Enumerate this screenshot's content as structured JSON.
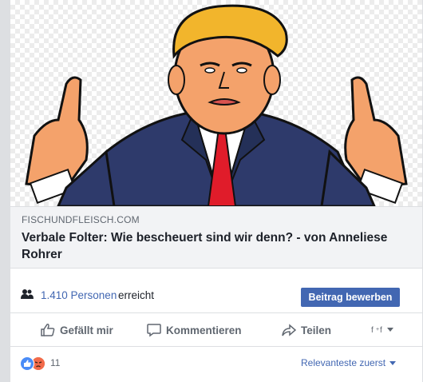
{
  "link_preview": {
    "domain": "FISCHUNDFLEISCH.COM",
    "title": "Verbale Folter: Wie bescheuert sind wir denn? - von Anneliese Rohrer"
  },
  "reach": {
    "count": "1.410 Personen",
    "suffix": "erreicht",
    "boost_label": "Beitrag bewerben"
  },
  "actions": {
    "like": "Gefällt mir",
    "comment": "Kommentieren",
    "share": "Teilen"
  },
  "reactions": {
    "count": "11",
    "sort_label": "Relevanteste zuerst"
  },
  "colors": {
    "accent": "#4267b2",
    "like_blue": "#4a8cf7",
    "tie_red": "#e01c2a",
    "suit": "#2e3a6b",
    "skin": "#f4a26b",
    "hair": "#f2b52c"
  }
}
